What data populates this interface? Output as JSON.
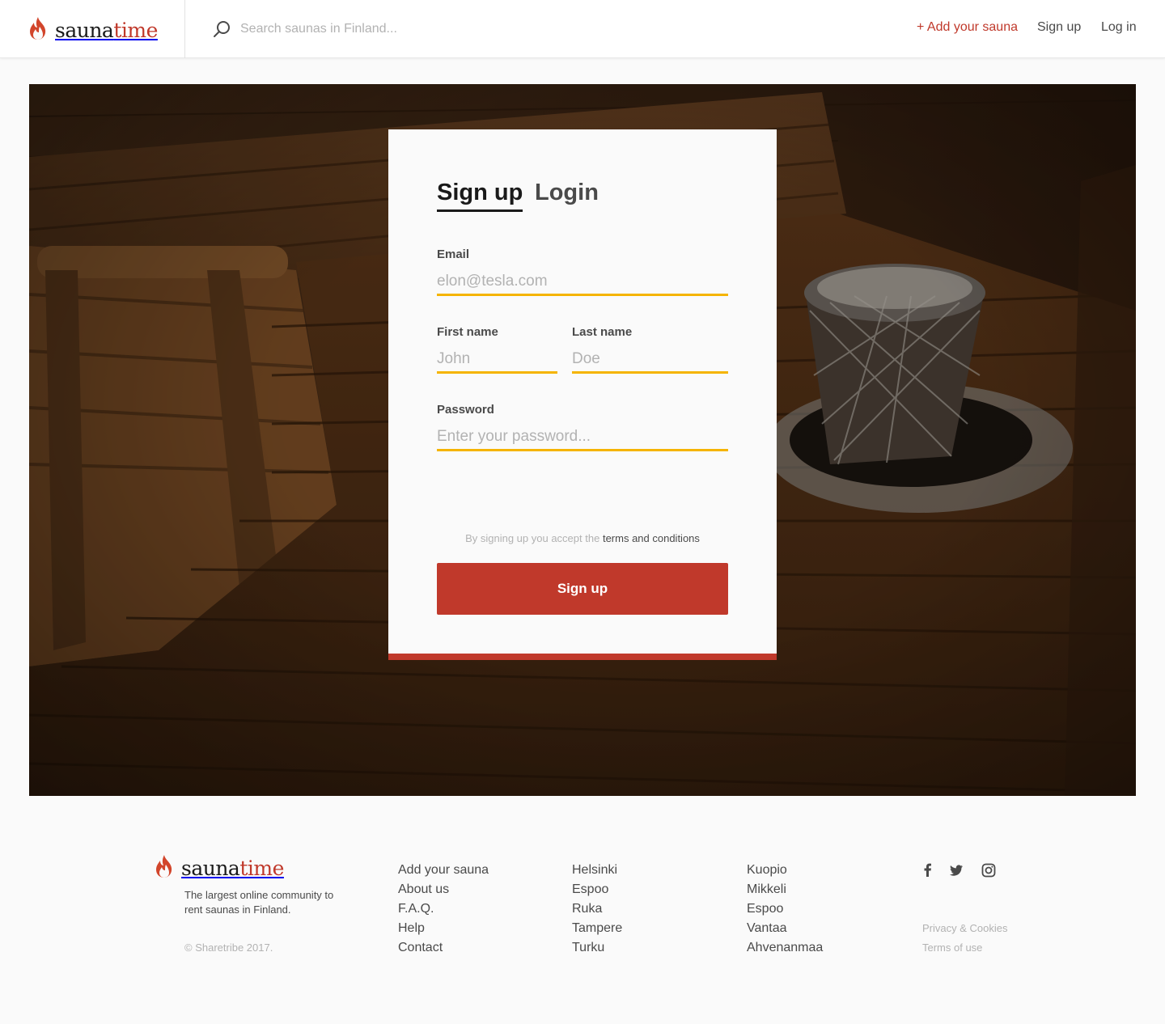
{
  "colors": {
    "brand": "#c0392b",
    "input_underline": "#f5b400",
    "text": "#4a4a4a",
    "muted": "#b2b2b2"
  },
  "header": {
    "logo": {
      "part1": "sauna",
      "part2": "time",
      "icon": "flame-icon"
    },
    "search": {
      "placeholder": "Search saunas in Finland...",
      "value": "",
      "icon": "search-icon"
    },
    "nav": {
      "add_sauna": "+ Add your sauna",
      "sign_up": "Sign up",
      "log_in": "Log in"
    }
  },
  "auth_card": {
    "tabs": {
      "sign_up": "Sign up",
      "login": "Login"
    },
    "active_tab": "Sign up",
    "fields": {
      "email": {
        "label": "Email",
        "placeholder": "elon@tesla.com",
        "value": ""
      },
      "first_name": {
        "label": "First name",
        "placeholder": "John",
        "value": ""
      },
      "last_name": {
        "label": "Last name",
        "placeholder": "Doe",
        "value": ""
      },
      "password": {
        "label": "Password",
        "placeholder": "Enter your password...",
        "value": ""
      }
    },
    "terms_prefix": "By signing up you accept the",
    "terms_link": "terms and conditions",
    "submit": "Sign up"
  },
  "footer": {
    "logo": {
      "part1": "sauna",
      "part2": "time"
    },
    "tagline": "The largest online community to rent saunas in Finland.",
    "copyright": "© Sharetribe 2017.",
    "links": [
      "Add your sauna",
      "About us",
      "F.A.Q.",
      "Help",
      "Contact"
    ],
    "cities_1": [
      "Helsinki",
      "Espoo",
      "Ruka",
      "Tampere",
      "Turku"
    ],
    "cities_2": [
      "Kuopio",
      "Mikkeli",
      "Espoo",
      "Vantaa",
      "Ahvenanmaa"
    ],
    "social": [
      "facebook-icon",
      "twitter-icon",
      "instagram-icon"
    ],
    "legal": {
      "privacy": "Privacy & Cookies",
      "terms": "Terms of use"
    }
  }
}
